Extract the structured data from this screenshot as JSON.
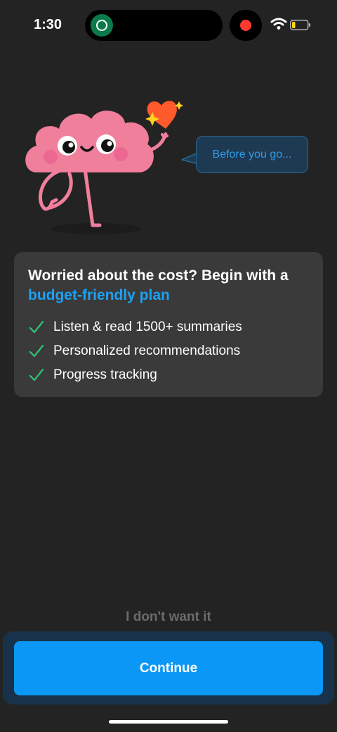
{
  "status_bar": {
    "time": "1:30",
    "icons": [
      "starbucks-app-icon",
      "record-indicator-icon",
      "wifi-icon",
      "battery-icon"
    ]
  },
  "mascot": {
    "icon": "brain-mascot-icon",
    "heart_icon": "heart-icon",
    "bubble_text": "Before you go..."
  },
  "offer": {
    "title_prefix": "Worried about the cost? Begin with a ",
    "title_accent": "budget-friendly plan",
    "features": [
      "Listen & read 1500+ summaries",
      "Personalized recommendations",
      "Progress tracking"
    ],
    "check_icon": "checkmark-icon"
  },
  "actions": {
    "decline_label": "I don't want it",
    "continue_label": "Continue"
  },
  "colors": {
    "background": "#232323",
    "card": "#3a3a3a",
    "accent": "#1da1f2",
    "check": "#2ecc71",
    "button": "#0a97f5",
    "mascot": "#f07f9c",
    "heart": "#ff5a2c"
  }
}
